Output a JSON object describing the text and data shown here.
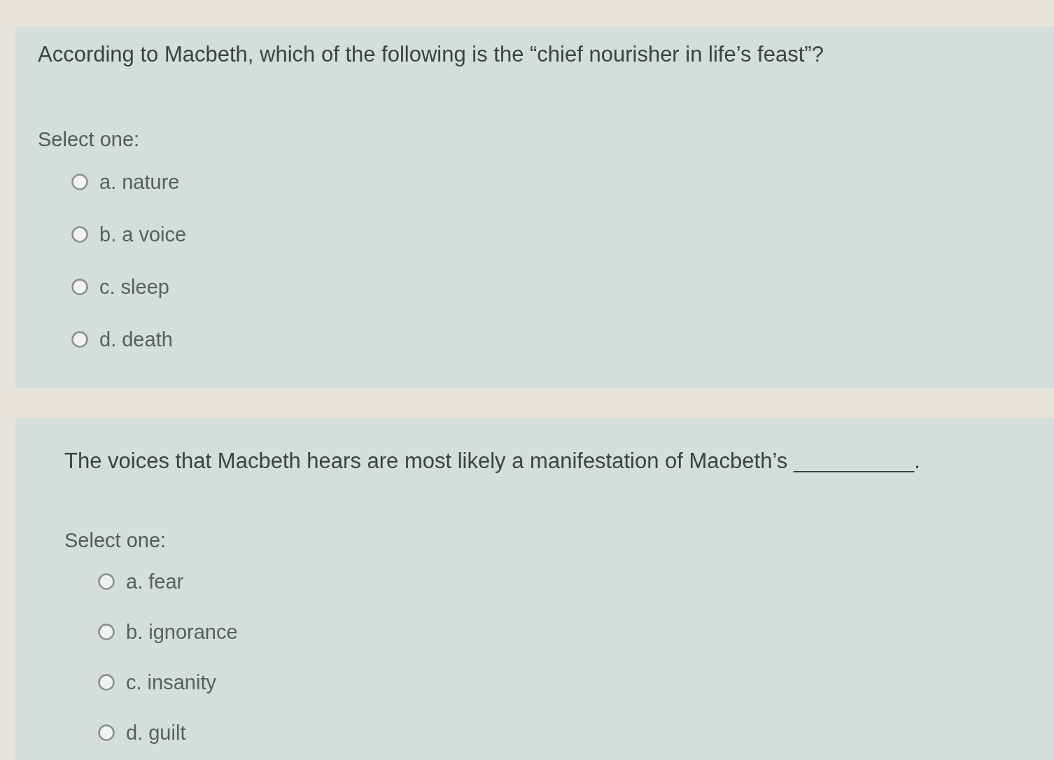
{
  "questions": [
    {
      "prompt": "According to Macbeth, which of the following is the “chief nourisher in life’s feast”?",
      "instruction": "Select one:",
      "options": [
        {
          "label": "a. nature",
          "selected": false
        },
        {
          "label": "b. a voice",
          "selected": false
        },
        {
          "label": "c. sleep",
          "selected": false
        },
        {
          "label": "d. death",
          "selected": false
        }
      ]
    },
    {
      "prompt": "The voices that Macbeth hears are most likely a manifestation of Macbeth’s  __________.",
      "instruction": "Select one:",
      "options": [
        {
          "label": "a. fear",
          "selected": false
        },
        {
          "label": "b. ignorance",
          "selected": false
        },
        {
          "label": "c. insanity",
          "selected": false
        },
        {
          "label": "d. guilt",
          "selected": false
        }
      ]
    }
  ]
}
